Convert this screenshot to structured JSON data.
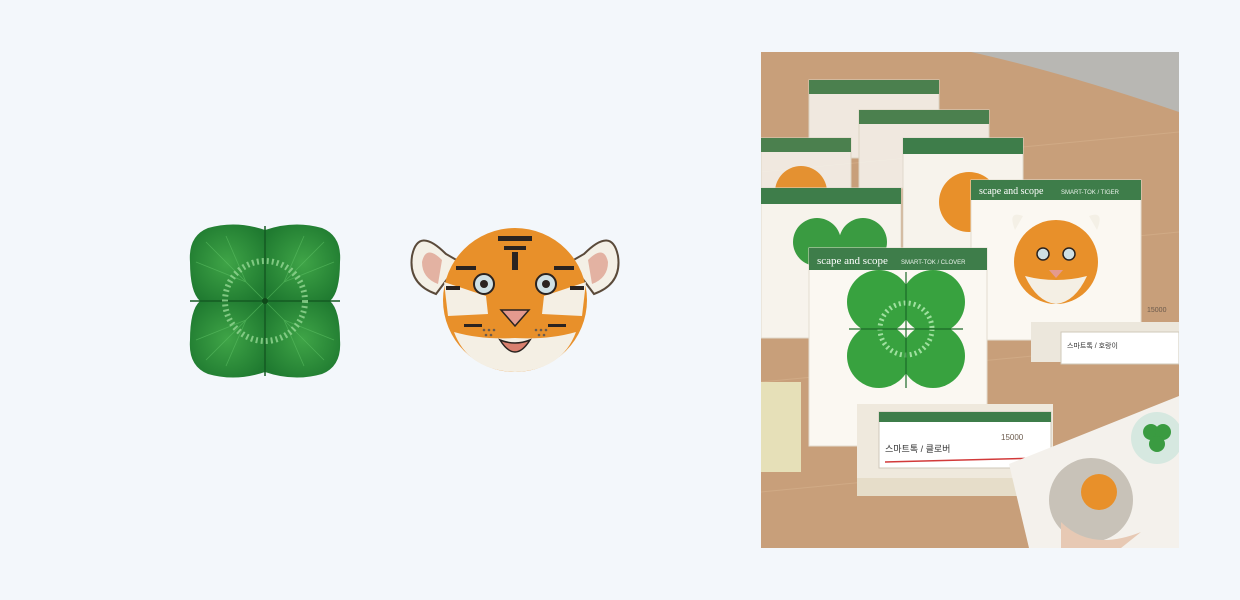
{
  "product": {
    "brand": "scape and scope",
    "clover_sku": "SMART-TOK / CLOVER",
    "tiger_sku": "SMART-TOK / TIGER",
    "clover_price": "15000",
    "tiger_price": "15000",
    "clover_card_title": "스마트톡 / 클로버",
    "tiger_card_title": "스마트톡 / 호랑이"
  },
  "colors": {
    "background": "#f3f7fb",
    "clover_green": "#2e8b3a",
    "tiger_orange": "#e8902a",
    "tag_green": "#3e7d4a"
  }
}
